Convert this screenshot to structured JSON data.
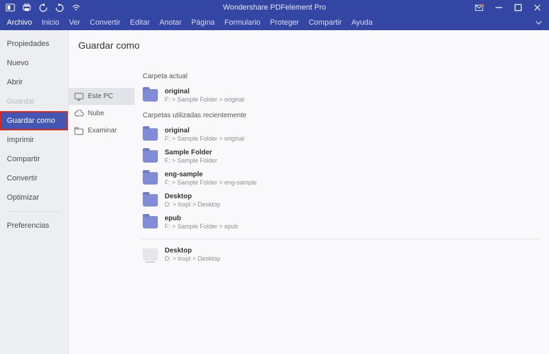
{
  "app_title": "Wondershare PDFelement Pro",
  "menubar": [
    "Archivo",
    "Inicio",
    "Ver",
    "Convertir",
    "Editar",
    "Anotar",
    "Página",
    "Formulario",
    "Proteger",
    "Compartir",
    "Ayuda"
  ],
  "menubar_active_index": 0,
  "sidebar": {
    "items": [
      {
        "label": "Propiedades",
        "disabled": false
      },
      {
        "label": "Nuevo",
        "disabled": false
      },
      {
        "label": "Abrir",
        "disabled": false
      },
      {
        "label": "Guardar",
        "disabled": true
      },
      {
        "label": "Guardar como",
        "selected": true
      },
      {
        "label": "Imprimir",
        "disabled": false
      },
      {
        "label": "Compartir",
        "disabled": false
      },
      {
        "label": "Convertir",
        "disabled": false
      },
      {
        "label": "Optimizar",
        "disabled": false
      }
    ],
    "footer_item": {
      "label": "Preferencias"
    }
  },
  "panel_title": "Guardar como",
  "sources": [
    {
      "label": "Este PC",
      "selected": true,
      "icon": "monitor-icon"
    },
    {
      "label": "Nube",
      "selected": false,
      "icon": "cloud-icon"
    },
    {
      "label": "Examinar",
      "selected": false,
      "icon": "browse-icon"
    }
  ],
  "sections": {
    "current_label": "Carpeta actual",
    "recent_label": "Carpetas utilizadas recientemente",
    "current": [
      {
        "name": "original",
        "path": "F: > Sample Folder > original"
      }
    ],
    "recent": [
      {
        "name": "original",
        "path": "F: > Sample Folder > original"
      },
      {
        "name": "Sample Folder",
        "path": "F: > Sample Folder"
      },
      {
        "name": "eng-sample",
        "path": "F: > Sample Folder > eng-sample"
      },
      {
        "name": "Desktop",
        "path": "D: > lnxpl > Desktop"
      },
      {
        "name": "epub",
        "path": "F: > Sample Folder > epub"
      }
    ],
    "other": [
      {
        "name": "Desktop",
        "path": "D: > lnxpl > Desktop",
        "desktop": true
      }
    ]
  }
}
